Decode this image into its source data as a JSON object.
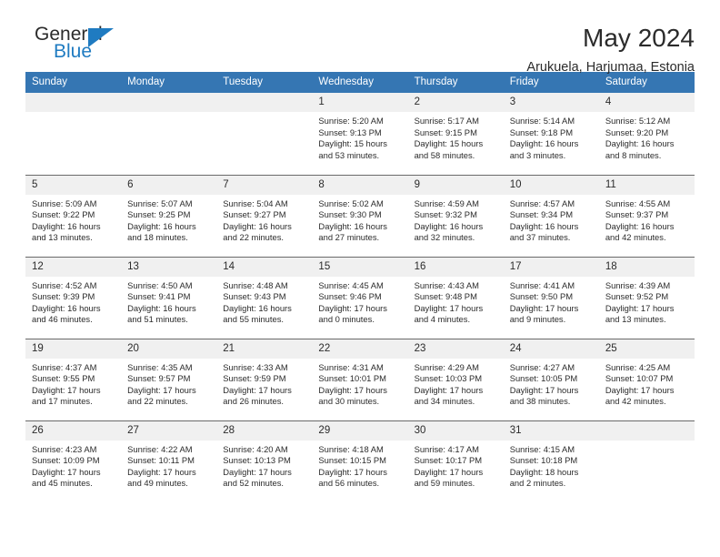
{
  "brand": {
    "name_top": "General",
    "name_bottom": "Blue",
    "accent_color": "#1f7bc1"
  },
  "header": {
    "title": "May 2024",
    "subtitle": "Arukuela, Harjumaa, Estonia",
    "header_bg_color": "#3576b3"
  },
  "weekday_headers": [
    "Sunday",
    "Monday",
    "Tuesday",
    "Wednesday",
    "Thursday",
    "Friday",
    "Saturday"
  ],
  "labels": {
    "sunrise_prefix": "Sunrise:",
    "sunset_prefix": "Sunset:",
    "daylight_prefix": "Daylight:"
  },
  "weeks": [
    [
      {
        "day": "",
        "empty": true
      },
      {
        "day": "",
        "empty": true
      },
      {
        "day": "",
        "empty": true
      },
      {
        "day": "1",
        "sunrise": "Sunrise: 5:20 AM",
        "sunset": "Sunset: 9:13 PM",
        "daylight_line1": "Daylight: 15 hours",
        "daylight_line2": "and 53 minutes."
      },
      {
        "day": "2",
        "sunrise": "Sunrise: 5:17 AM",
        "sunset": "Sunset: 9:15 PM",
        "daylight_line1": "Daylight: 15 hours",
        "daylight_line2": "and 58 minutes."
      },
      {
        "day": "3",
        "sunrise": "Sunrise: 5:14 AM",
        "sunset": "Sunset: 9:18 PM",
        "daylight_line1": "Daylight: 16 hours",
        "daylight_line2": "and 3 minutes."
      },
      {
        "day": "4",
        "sunrise": "Sunrise: 5:12 AM",
        "sunset": "Sunset: 9:20 PM",
        "daylight_line1": "Daylight: 16 hours",
        "daylight_line2": "and 8 minutes."
      }
    ],
    [
      {
        "day": "5",
        "sunrise": "Sunrise: 5:09 AM",
        "sunset": "Sunset: 9:22 PM",
        "daylight_line1": "Daylight: 16 hours",
        "daylight_line2": "and 13 minutes."
      },
      {
        "day": "6",
        "sunrise": "Sunrise: 5:07 AM",
        "sunset": "Sunset: 9:25 PM",
        "daylight_line1": "Daylight: 16 hours",
        "daylight_line2": "and 18 minutes."
      },
      {
        "day": "7",
        "sunrise": "Sunrise: 5:04 AM",
        "sunset": "Sunset: 9:27 PM",
        "daylight_line1": "Daylight: 16 hours",
        "daylight_line2": "and 22 minutes."
      },
      {
        "day": "8",
        "sunrise": "Sunrise: 5:02 AM",
        "sunset": "Sunset: 9:30 PM",
        "daylight_line1": "Daylight: 16 hours",
        "daylight_line2": "and 27 minutes."
      },
      {
        "day": "9",
        "sunrise": "Sunrise: 4:59 AM",
        "sunset": "Sunset: 9:32 PM",
        "daylight_line1": "Daylight: 16 hours",
        "daylight_line2": "and 32 minutes."
      },
      {
        "day": "10",
        "sunrise": "Sunrise: 4:57 AM",
        "sunset": "Sunset: 9:34 PM",
        "daylight_line1": "Daylight: 16 hours",
        "daylight_line2": "and 37 minutes."
      },
      {
        "day": "11",
        "sunrise": "Sunrise: 4:55 AM",
        "sunset": "Sunset: 9:37 PM",
        "daylight_line1": "Daylight: 16 hours",
        "daylight_line2": "and 42 minutes."
      }
    ],
    [
      {
        "day": "12",
        "sunrise": "Sunrise: 4:52 AM",
        "sunset": "Sunset: 9:39 PM",
        "daylight_line1": "Daylight: 16 hours",
        "daylight_line2": "and 46 minutes."
      },
      {
        "day": "13",
        "sunrise": "Sunrise: 4:50 AM",
        "sunset": "Sunset: 9:41 PM",
        "daylight_line1": "Daylight: 16 hours",
        "daylight_line2": "and 51 minutes."
      },
      {
        "day": "14",
        "sunrise": "Sunrise: 4:48 AM",
        "sunset": "Sunset: 9:43 PM",
        "daylight_line1": "Daylight: 16 hours",
        "daylight_line2": "and 55 minutes."
      },
      {
        "day": "15",
        "sunrise": "Sunrise: 4:45 AM",
        "sunset": "Sunset: 9:46 PM",
        "daylight_line1": "Daylight: 17 hours",
        "daylight_line2": "and 0 minutes."
      },
      {
        "day": "16",
        "sunrise": "Sunrise: 4:43 AM",
        "sunset": "Sunset: 9:48 PM",
        "daylight_line1": "Daylight: 17 hours",
        "daylight_line2": "and 4 minutes."
      },
      {
        "day": "17",
        "sunrise": "Sunrise: 4:41 AM",
        "sunset": "Sunset: 9:50 PM",
        "daylight_line1": "Daylight: 17 hours",
        "daylight_line2": "and 9 minutes."
      },
      {
        "day": "18",
        "sunrise": "Sunrise: 4:39 AM",
        "sunset": "Sunset: 9:52 PM",
        "daylight_line1": "Daylight: 17 hours",
        "daylight_line2": "and 13 minutes."
      }
    ],
    [
      {
        "day": "19",
        "sunrise": "Sunrise: 4:37 AM",
        "sunset": "Sunset: 9:55 PM",
        "daylight_line1": "Daylight: 17 hours",
        "daylight_line2": "and 17 minutes."
      },
      {
        "day": "20",
        "sunrise": "Sunrise: 4:35 AM",
        "sunset": "Sunset: 9:57 PM",
        "daylight_line1": "Daylight: 17 hours",
        "daylight_line2": "and 22 minutes."
      },
      {
        "day": "21",
        "sunrise": "Sunrise: 4:33 AM",
        "sunset": "Sunset: 9:59 PM",
        "daylight_line1": "Daylight: 17 hours",
        "daylight_line2": "and 26 minutes."
      },
      {
        "day": "22",
        "sunrise": "Sunrise: 4:31 AM",
        "sunset": "Sunset: 10:01 PM",
        "daylight_line1": "Daylight: 17 hours",
        "daylight_line2": "and 30 minutes."
      },
      {
        "day": "23",
        "sunrise": "Sunrise: 4:29 AM",
        "sunset": "Sunset: 10:03 PM",
        "daylight_line1": "Daylight: 17 hours",
        "daylight_line2": "and 34 minutes."
      },
      {
        "day": "24",
        "sunrise": "Sunrise: 4:27 AM",
        "sunset": "Sunset: 10:05 PM",
        "daylight_line1": "Daylight: 17 hours",
        "daylight_line2": "and 38 minutes."
      },
      {
        "day": "25",
        "sunrise": "Sunrise: 4:25 AM",
        "sunset": "Sunset: 10:07 PM",
        "daylight_line1": "Daylight: 17 hours",
        "daylight_line2": "and 42 minutes."
      }
    ],
    [
      {
        "day": "26",
        "sunrise": "Sunrise: 4:23 AM",
        "sunset": "Sunset: 10:09 PM",
        "daylight_line1": "Daylight: 17 hours",
        "daylight_line2": "and 45 minutes."
      },
      {
        "day": "27",
        "sunrise": "Sunrise: 4:22 AM",
        "sunset": "Sunset: 10:11 PM",
        "daylight_line1": "Daylight: 17 hours",
        "daylight_line2": "and 49 minutes."
      },
      {
        "day": "28",
        "sunrise": "Sunrise: 4:20 AM",
        "sunset": "Sunset: 10:13 PM",
        "daylight_line1": "Daylight: 17 hours",
        "daylight_line2": "and 52 minutes."
      },
      {
        "day": "29",
        "sunrise": "Sunrise: 4:18 AM",
        "sunset": "Sunset: 10:15 PM",
        "daylight_line1": "Daylight: 17 hours",
        "daylight_line2": "and 56 minutes."
      },
      {
        "day": "30",
        "sunrise": "Sunrise: 4:17 AM",
        "sunset": "Sunset: 10:17 PM",
        "daylight_line1": "Daylight: 17 hours",
        "daylight_line2": "and 59 minutes."
      },
      {
        "day": "31",
        "sunrise": "Sunrise: 4:15 AM",
        "sunset": "Sunset: 10:18 PM",
        "daylight_line1": "Daylight: 18 hours",
        "daylight_line2": "and 2 minutes."
      },
      {
        "day": "",
        "empty": true
      }
    ]
  ]
}
